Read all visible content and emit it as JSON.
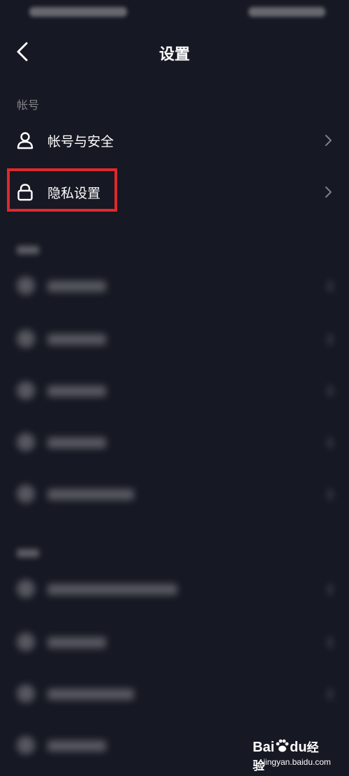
{
  "header": {
    "title": "设置"
  },
  "sections": {
    "account": {
      "label": "帐号"
    }
  },
  "account_items": [
    {
      "label": "帐号与安全",
      "icon": "person-icon"
    },
    {
      "label": "隐私设置",
      "icon": "lock-icon"
    }
  ],
  "colors": {
    "background": "#161823",
    "highlight": "#e0282b"
  },
  "watermark": {
    "brand_bai": "Bai",
    "brand_du": "du",
    "brand_jingyan": "经验",
    "url": "jingyan.baidu.com"
  }
}
